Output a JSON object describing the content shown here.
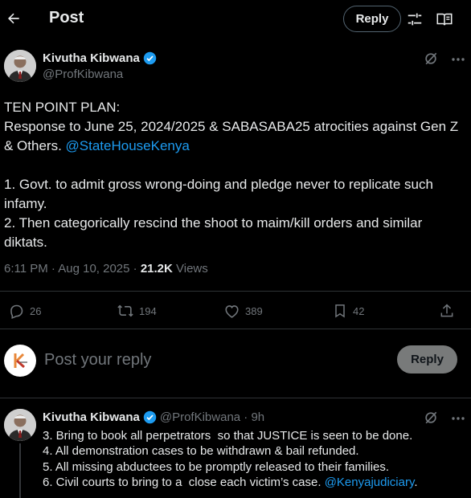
{
  "header": {
    "title": "Post",
    "reply_label": "Reply",
    "icons": [
      "back-arrow-icon",
      "sliders-icon",
      "reader-icon"
    ]
  },
  "tweet": {
    "author_name": "Kivutha Kibwana",
    "author_handle": "@ProfKibwana",
    "verified": true,
    "body_pre": "TEN POINT PLAN:\nResponse to June 25, 2024/2025 & SABASABA25 atrocities against Gen Z & Others. ",
    "mention": "@StateHouseKenya",
    "body_post": "\n\n1. Govt. to admit gross wrong-doing and pledge never to replicate such infamy.\n2. Then categorically rescind the shoot to maim/kill orders and similar diktats.",
    "time": "6:11 PM · Aug 10, 2025 · ",
    "views_count": "21.2K",
    "views_label": " Views",
    "actions": {
      "replies": "26",
      "reposts": "194",
      "likes": "389",
      "bookmarks": "42"
    }
  },
  "composer": {
    "placeholder": "Post your reply",
    "button_label": "Reply"
  },
  "reply_tweet": {
    "author_name": "Kivutha Kibwana",
    "author_handle": "@ProfKibwana · 9h",
    "body_pre": "3. Bring to book all perpetrators  so that JUSTICE is seen to be done.\n4. All demonstration cases to be withdrawn & bail refunded.\n5. All missing abductees to be promptly released to their families.\n6. Civil courts to bring to a  close each victim’s case. ",
    "mention": "@Kenyajudiciary",
    "body_post": "."
  },
  "colors": {
    "background": "#000000",
    "text": "#e7e9ea",
    "muted": "#71767b",
    "link": "#1d9bf0",
    "verified": "#1d9bf0",
    "divider": "#2f3336"
  }
}
